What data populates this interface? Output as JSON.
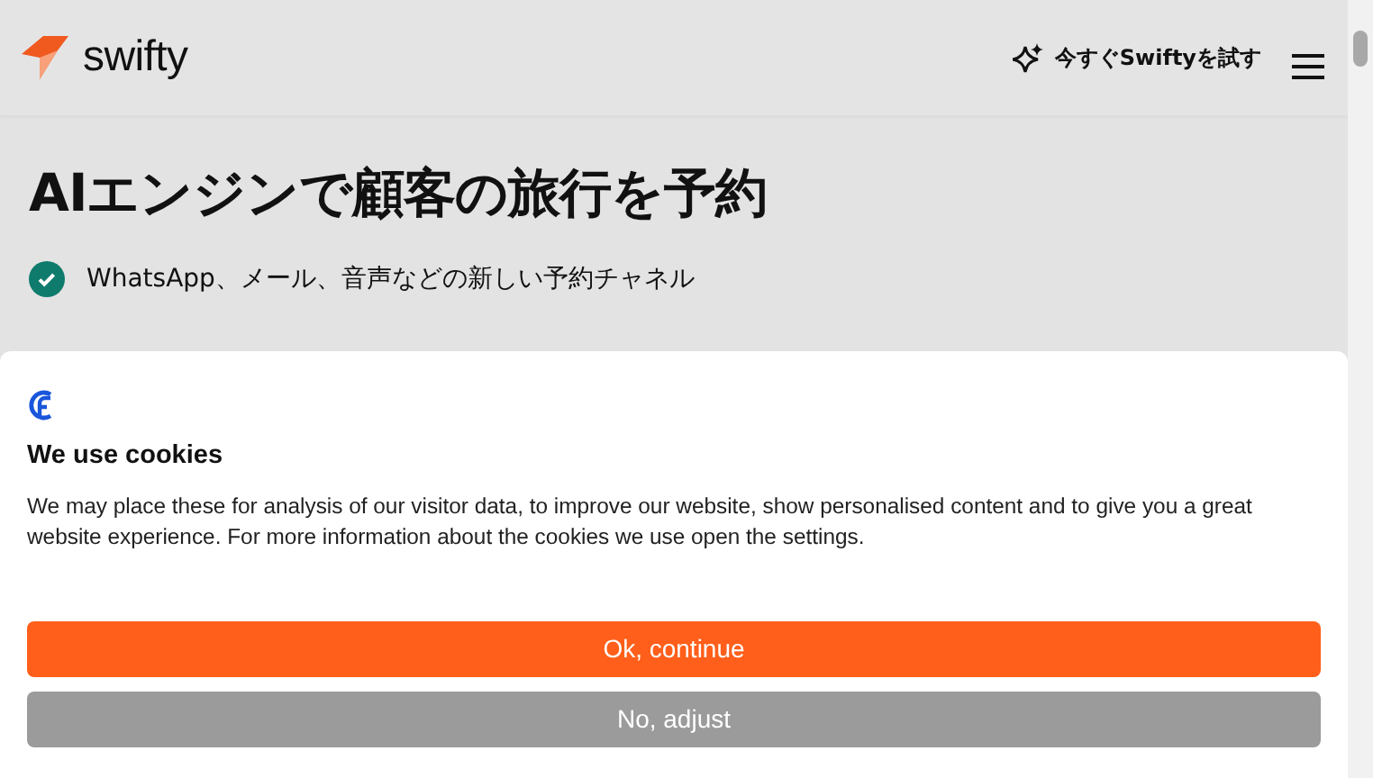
{
  "header": {
    "logo_text": "swifty",
    "cta": "今すぐSwiftyを試す"
  },
  "hero": {
    "title": "AIエンジンで顧客の旅行を予約",
    "bullets": [
      "WhatsApp、メール、音声などの新しい予約チャネル"
    ]
  },
  "cookie_banner": {
    "title": "We use cookies",
    "text": "We may place these for analysis of our visitor data, to improve our website, show personalised content and to give you a great website experience. For more information about the cookies we use open the settings.",
    "buttons": [
      {
        "label": "Ok, continue",
        "kind": "primary"
      },
      {
        "label": "No, adjust",
        "kind": "secondary"
      }
    ]
  }
}
